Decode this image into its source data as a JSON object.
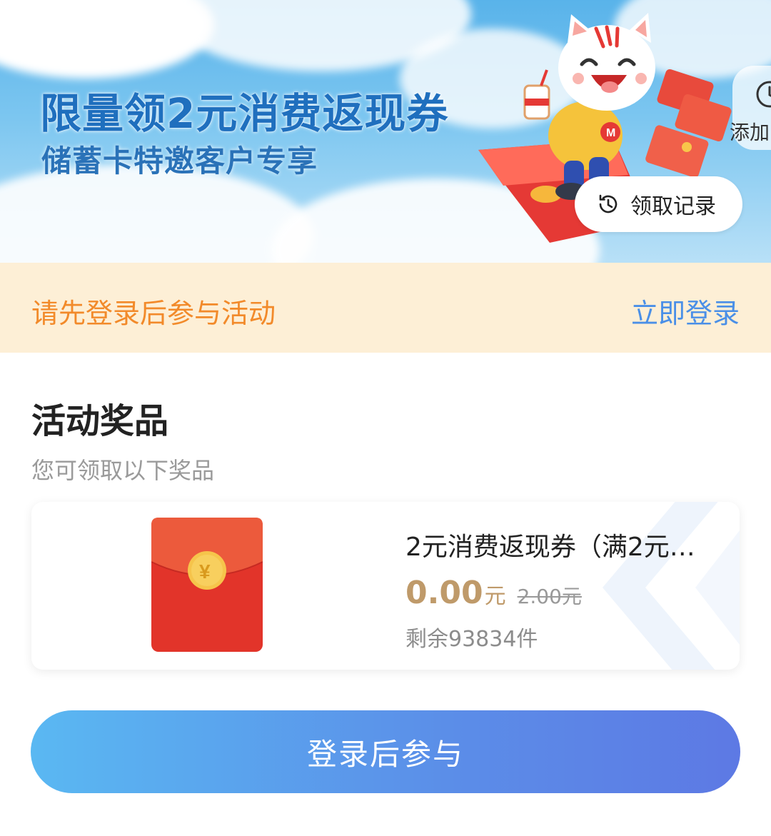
{
  "banner": {
    "title": "限量领2元消费返现券",
    "subtitle": "储蓄卡特邀客户专享",
    "side_chip_label": "添加",
    "record_button_label": "领取记录"
  },
  "login_bar": {
    "prompt": "请先登录后参与活动",
    "link_label": "立即登录"
  },
  "section": {
    "title": "活动奖品",
    "subtitle": "您可领取以下奖品"
  },
  "prize": {
    "name": "2元消费返现券（满2元…",
    "price": "0.00",
    "price_unit": "元",
    "original_price": "2.00元",
    "stock": "剩余93834件",
    "icon": "red-envelope-icon"
  },
  "cta": {
    "label": "登录后参与"
  },
  "colors": {
    "accent_orange": "#f28a2a",
    "link_blue": "#4a8fe7",
    "price_gold": "#bf9a6a",
    "login_bar_bg": "#fdefd6"
  }
}
